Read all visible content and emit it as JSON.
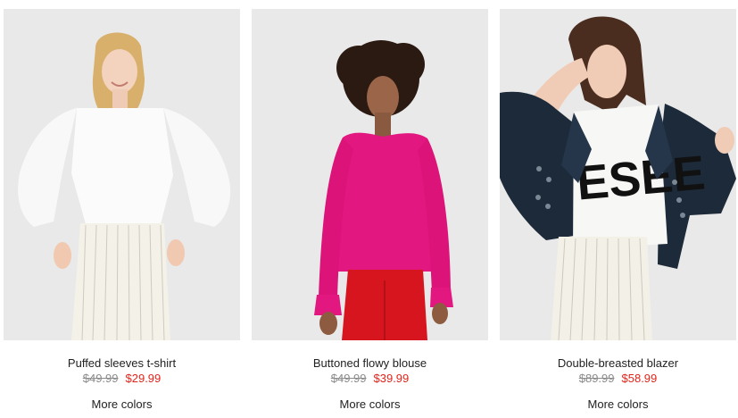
{
  "products": [
    {
      "name": "Puffed sleeves t-shirt",
      "old_price": "$49.99",
      "sale_price": "$29.99",
      "more_colors": "More colors"
    },
    {
      "name": "Buttoned flowy blouse",
      "old_price": "$49.99",
      "sale_price": "$39.99",
      "more_colors": "More colors"
    },
    {
      "name": "Double-breasted blazer",
      "old_price": "$89.99",
      "sale_price": "$58.99",
      "more_colors": "More colors"
    }
  ],
  "graphic_text": {
    "tshirt_print": "ESEE"
  },
  "colors": {
    "sale_price": "#e2231a",
    "old_price": "#8a8a8a",
    "photo_background": "#e9e9e9",
    "text": "#222222"
  }
}
